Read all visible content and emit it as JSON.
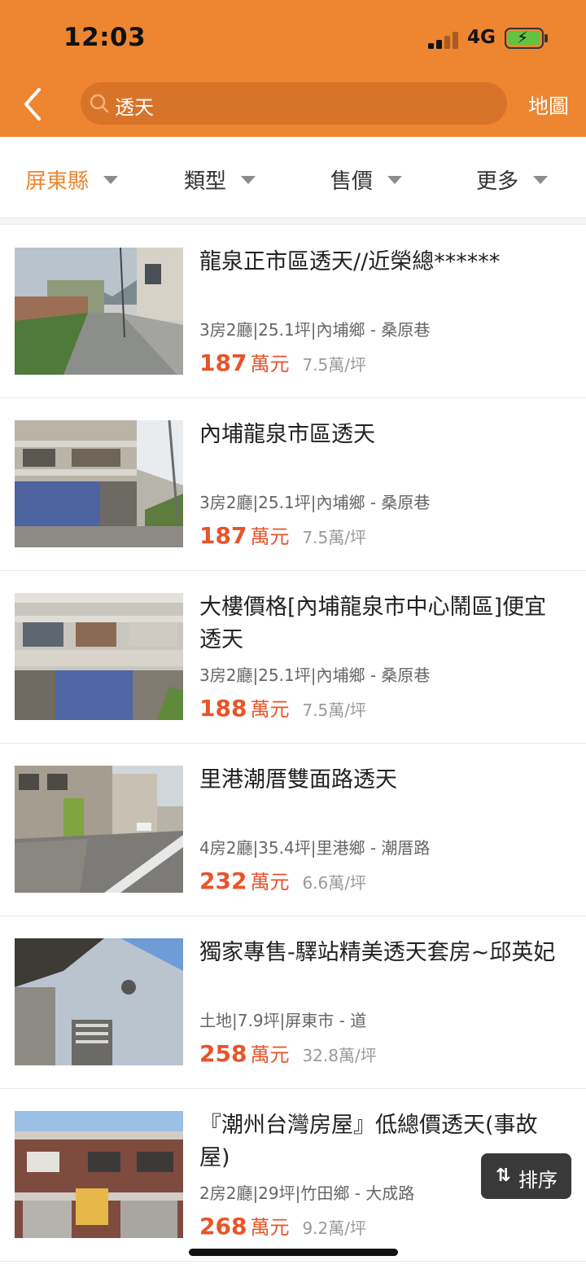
{
  "status_bar": {
    "time": "12:03",
    "network": "4G",
    "battery_icon": "battery-charging-icon",
    "signal_icon": "signal-bars-icon"
  },
  "header": {
    "back_icon": "chevron-left-icon",
    "search_icon": "search-icon",
    "search_value": "透天",
    "map_label": "地圖"
  },
  "filters": [
    {
      "label": "屏東縣",
      "active": true
    },
    {
      "label": "類型",
      "active": false
    },
    {
      "label": "售價",
      "active": false
    },
    {
      "label": "更多",
      "active": false
    }
  ],
  "listings": [
    {
      "title": "龍泉正市區透天//近榮總******",
      "meta": "3房2廳|25.1坪|內埔鄉 - 桑原巷",
      "price": "187",
      "price_unit": "萬元",
      "unit_price": "7.5萬/坪"
    },
    {
      "title": "內埔龍泉市區透天",
      "meta": "3房2廳|25.1坪|內埔鄉 - 桑原巷",
      "price": "187",
      "price_unit": "萬元",
      "unit_price": "7.5萬/坪"
    },
    {
      "title": "大樓價格[內埔龍泉市中心鬧區]便宜透天",
      "meta": "3房2廳|25.1坪|內埔鄉 - 桑原巷",
      "price": "188",
      "price_unit": "萬元",
      "unit_price": "7.5萬/坪"
    },
    {
      "title": "里港潮厝雙面路透天",
      "meta": "4房2廳|35.4坪|里港鄉 - 潮厝路",
      "price": "232",
      "price_unit": "萬元",
      "unit_price": "6.6萬/坪"
    },
    {
      "title": "獨家專售-驛站精美透天套房~邱英妃",
      "meta": "土地|7.9坪|屏東市 - 道",
      "price": "258",
      "price_unit": "萬元",
      "unit_price": "32.8萬/坪"
    },
    {
      "title": "『潮州台灣房屋』低總價透天(事故屋)",
      "meta": "2房2廳|29坪|竹田鄉 - 大成路",
      "price": "268",
      "price_unit": "萬元",
      "unit_price": "9.2萬/坪"
    }
  ],
  "sort_button": {
    "icon": "sort-arrows-icon",
    "label": "排序"
  },
  "colors": {
    "brand": "#ee8531",
    "price": "#e8542a"
  }
}
